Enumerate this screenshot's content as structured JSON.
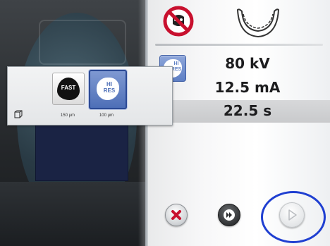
{
  "exposure": {
    "kv": "80 kV",
    "ma": "12.5 mA",
    "time": "22.5 s",
    "mode_badge_label": "HI RES"
  },
  "resolution_popup": {
    "options": [
      {
        "label": "FAST",
        "resolution": "150 µm",
        "selected": false
      },
      {
        "label": "HI RES",
        "resolution": "100 µm",
        "selected": true
      }
    ]
  },
  "icons": {
    "no_metal": "no-metal-icon",
    "bite": "bite-block-icon",
    "volume": "cube-icon",
    "cancel": "cancel-icon",
    "fast_forward": "fast-forward-icon",
    "play": "play-icon"
  },
  "colors": {
    "accent_blue": "#5e7fc4",
    "cancel_red": "#c8102e",
    "highlight_ring": "#1f3fd1"
  }
}
